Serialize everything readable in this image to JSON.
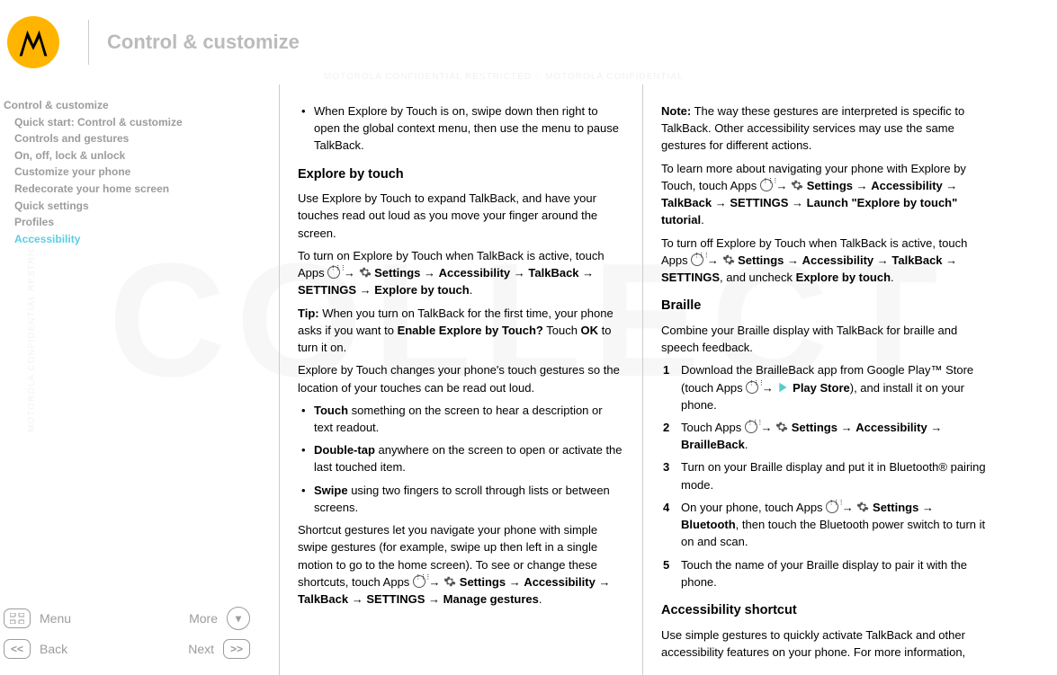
{
  "header": {
    "title": "Control & customize"
  },
  "toc": {
    "level1": "Control & customize",
    "items": [
      "Quick start: Control & customize",
      "Controls and gestures",
      "On, off, lock & unlock",
      "Customize your phone",
      "Redecorate your home screen",
      "Quick settings",
      "Profiles",
      "Accessibility"
    ],
    "active_index": 7
  },
  "nav": {
    "menu": "Menu",
    "more": "More",
    "back": "Back",
    "next": "Next"
  },
  "col1": {
    "bullet1": "When Explore by Touch is on, swipe down then right to open the global context menu, then use the menu to pause TalkBack.",
    "h_explore": "Explore by touch",
    "p_explore1": "Use Explore by Touch to expand TalkBack, and have your touches read out loud as you move your finger around the screen.",
    "p_explore2a": "To turn on Explore by Touch when TalkBack is active, touch Apps ",
    "p_explore2b": " Settings",
    "p_explore2c": "Accessibility",
    "p_explore2d": "TalkBack",
    "p_explore2e": "SETTINGS",
    "p_explore2f": "Explore by touch",
    "tip_label": "Tip:",
    "tip_body1": " When you turn on TalkBack for the first time, your phone asks if you want to ",
    "tip_strong": "Enable Explore by Touch?",
    "tip_body2": " Touch ",
    "tip_ok": "OK",
    "tip_body3": " to turn it on.",
    "p_expl_changes": "Explore by Touch changes your phone's touch gestures so the location of your touches can be read out loud.",
    "li_touch_s": "Touch",
    "li_touch_b": " something on the screen to hear a description or text readout.",
    "li_dbl_s": "Double-tap",
    "li_dbl_b": " anywhere on the screen to open or activate the last touched item.",
    "li_swipe_s": "Swipe",
    "li_swipe_b": " using two fingers to scroll through lists or between screens.",
    "p_shortcut1": "Shortcut gestures let you navigate your phone with simple swipe gestures (for example, swipe up then left in a single motion to go to the home screen). To see or change these shortcuts, touch Apps ",
    "p_shortcut_s1": " Settings",
    "p_shortcut_s2": "Accessibility",
    "p_shortcut_s3": "TalkBack",
    "p_shortcut_s4": "SETTINGS",
    "p_shortcut_s5": "Manage gestures"
  },
  "col2": {
    "note_label": "Note:",
    "note_body": " The way these gestures are interpreted is specific to TalkBack. Other accessibility services may use the same gestures for different actions.",
    "p_learn1": "To learn more about navigating your phone with Explore by Touch, touch Apps ",
    "s_settings": " Settings",
    "s_access": "Accessibility",
    "s_talkback": "TalkBack",
    "s_SETTINGS": "SETTINGS",
    "s_launch": "Launch \"Explore by touch\" tutorial",
    "p_off1": "To turn off Explore by Touch when TalkBack is active, touch Apps ",
    "off_uncheck": ", and uncheck ",
    "off_ebt": "Explore by touch",
    "h_braille": "Braille",
    "p_braille1": "Combine your Braille display with TalkBack for braille and speech feedback.",
    "li1a": "Download the BrailleBack app from Google Play™ Store (touch Apps ",
    "li1_play": " Play Store",
    "li1b": "), and install it on your phone.",
    "li2a": "Touch Apps ",
    "li2_brailleback": "BrailleBack",
    "li3": "Turn on your Braille display and put it in Bluetooth® pairing mode.",
    "li4a": "On your phone, touch Apps ",
    "li4_bt": "Bluetooth",
    "li4b": ", then touch the Bluetooth power switch to turn it on and scan.",
    "li5": "Touch the name of your Braille display to pair it with the phone.",
    "h_acc_shortcut": "Accessibility shortcut",
    "p_acc_shortcut": "Use simple gestures to quickly activate TalkBack and other accessibility features on your phone. For more information,"
  }
}
